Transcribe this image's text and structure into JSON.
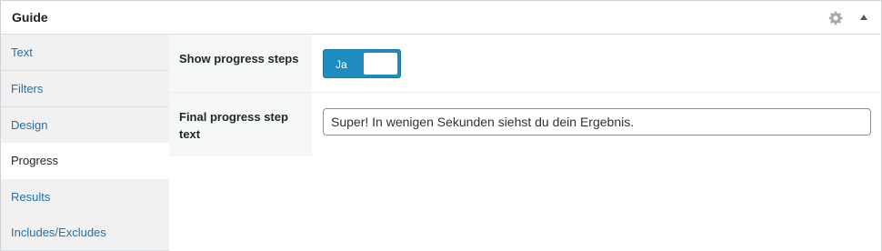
{
  "header": {
    "title": "Guide",
    "settings_icon": "gear-icon",
    "collapse_icon": "triangle-up-icon"
  },
  "sidebar": {
    "items": [
      {
        "label": "Text"
      },
      {
        "label": "Filters"
      },
      {
        "label": "Design"
      },
      {
        "label": "Progress",
        "active": true
      },
      {
        "label": "Results"
      },
      {
        "label": "Includes/Excludes"
      }
    ]
  },
  "fields": {
    "show_progress_steps": {
      "label": "Show progress steps",
      "toggle_text": "Ja",
      "enabled": true
    },
    "final_progress_step_text": {
      "label": "Final progress step text",
      "value": "Super! In wenigen Sekunden siehst du dein Ergebnis."
    }
  },
  "colors": {
    "accent": "#1e8cbe",
    "link": "#2271b1",
    "sidebar_bg": "#f1f1f1",
    "label_bg": "#f6f7f7"
  }
}
